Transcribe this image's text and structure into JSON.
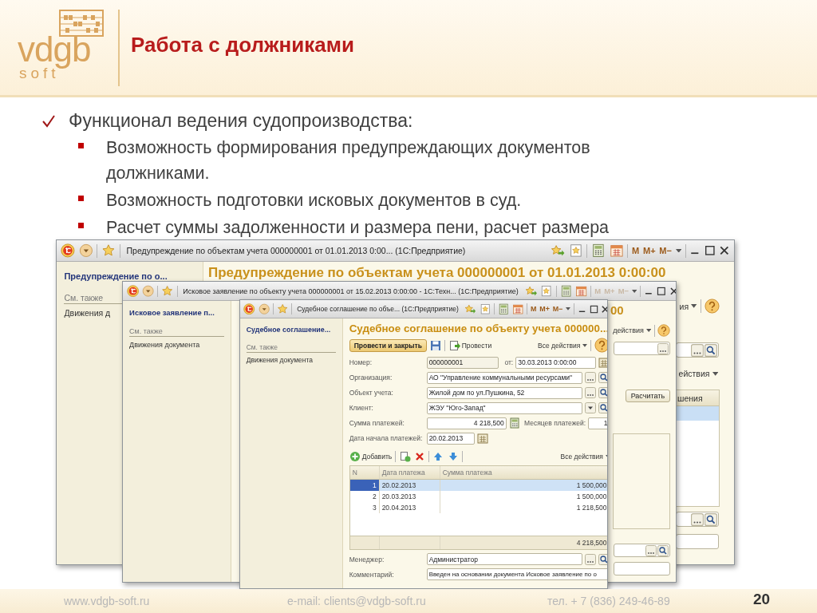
{
  "header": {
    "logo": {
      "wordmark": "vdgb",
      "subtitle": "soft"
    },
    "title": "Работа с должниками"
  },
  "bullets": [
    {
      "text": "Функционал ведения судопроизводства:",
      "children": [
        {
          "text": "Возможность формирования предупреждающих документов должниками."
        },
        {
          "text": "Возможность подготовки исковых документов в суд."
        },
        {
          "text": "Расчет суммы задолженности и размера пени, расчет размера"
        }
      ]
    }
  ],
  "windows": [
    {
      "title": "Предупреждение по объектам учета 000000001 от 01.01.2013 0:00...   (1С:Предприятие)",
      "memory_buttons": [
        "M",
        "M+",
        "M−"
      ],
      "sidebar": {
        "heading": "Предупреждение по о...",
        "section": "См. также",
        "links": [
          "Движения д"
        ]
      },
      "parts": [
        {
          "kind": "heading",
          "text": "Предупреждение по объектам учета 000000001 от 01.01.2013 0:00:00"
        },
        {
          "kind": "menu",
          "label": "ия",
          "help": true
        },
        {
          "kind": "lookup"
        },
        {
          "kind": "menu",
          "label": "ействия",
          "help": false
        },
        {
          "kind": "table",
          "column": "шения"
        },
        {
          "kind": "lookup"
        },
        {
          "kind": "field"
        }
      ]
    },
    {
      "title": "Исковое заявление по объекту учета 000000001 от 15.02.2013 0:00:00 - 1С:Техн...   (1С:Предприятие)",
      "memory_buttons": [
        "M",
        "M+",
        "M−"
      ],
      "sidebar": {
        "heading": "Исковое заявление п...",
        "section": "См. также",
        "links": [
          "Движения документа"
        ]
      },
      "parts": [
        {
          "kind": "heading",
          "text": "00"
        },
        {
          "kind": "menu",
          "label": "действия",
          "help": true
        },
        {
          "kind": "choice"
        },
        {
          "kind": "button",
          "label": "Расчитать"
        },
        {
          "kind": "box"
        },
        {
          "kind": "lookup"
        },
        {
          "kind": "field"
        }
      ]
    },
    {
      "title": "Судебное соглашение по объе...   (1С:Предприятие)",
      "memory_buttons": [
        "M",
        "M+",
        "M−"
      ],
      "sidebar": {
        "heading": "Судебное соглашение...",
        "section": "См. также",
        "links": [
          "Движения документа"
        ]
      },
      "form": {
        "heading": "Судебное соглашение по объекту учета 000000...",
        "toolbar": {
          "primary": "Провести и закрыть",
          "post": "Провести",
          "actions": "Все действия"
        },
        "fields": [
          {
            "kind": "number_date",
            "label": "Номер:",
            "value": "000000001",
            "date_label": "от:",
            "date": "30.03.2013  0:00:00"
          },
          {
            "kind": "lookup",
            "label": "Организация:",
            "value": "АО \"Управление коммунальными ресурсами\""
          },
          {
            "kind": "lookup",
            "label": "Объект учета:",
            "value": "Жилой дом по ул.Пушкина, 52"
          },
          {
            "kind": "select",
            "label": "Клиент:",
            "value": "ЖЭУ \"Юго-Запад\""
          },
          {
            "kind": "amount",
            "label": "Сумма платежей:",
            "value": "4 218,500",
            "extra_label": "Месяцев платежей:",
            "extra_value": "1"
          },
          {
            "kind": "date",
            "label": "Дата начала платежей:",
            "value": "20.02.2013"
          }
        ],
        "table_toolbar": {
          "add": "Добавить",
          "actions": "Все действия"
        },
        "table": {
          "columns": [
            "N",
            "Дата платежа",
            "Сумма платежа"
          ],
          "rows": [
            {
              "cells": [
                "1",
                "20.02.2013",
                "1 500,000"
              ],
              "selected": true
            },
            {
              "cells": [
                "2",
                "20.03.2013",
                "1 500,000"
              ],
              "selected": false
            },
            {
              "cells": [
                "3",
                "20.04.2013",
                "1 218,500"
              ],
              "selected": false
            }
          ],
          "total": "4 218,500"
        },
        "bottom_fields": [
          {
            "kind": "lookup",
            "label": "Менеджер:",
            "value": "Администратор"
          },
          {
            "kind": "text",
            "label": "Комментарий:",
            "value": "Введен на основании документа Исковое заявление по о"
          }
        ]
      }
    }
  ],
  "footer": {
    "website": "www.vdgb-soft.ru",
    "email": "e-mail: clients@vdgb-soft.ru",
    "phone": "тел. + 7 (836) 249-46-89",
    "page_number": "20"
  }
}
